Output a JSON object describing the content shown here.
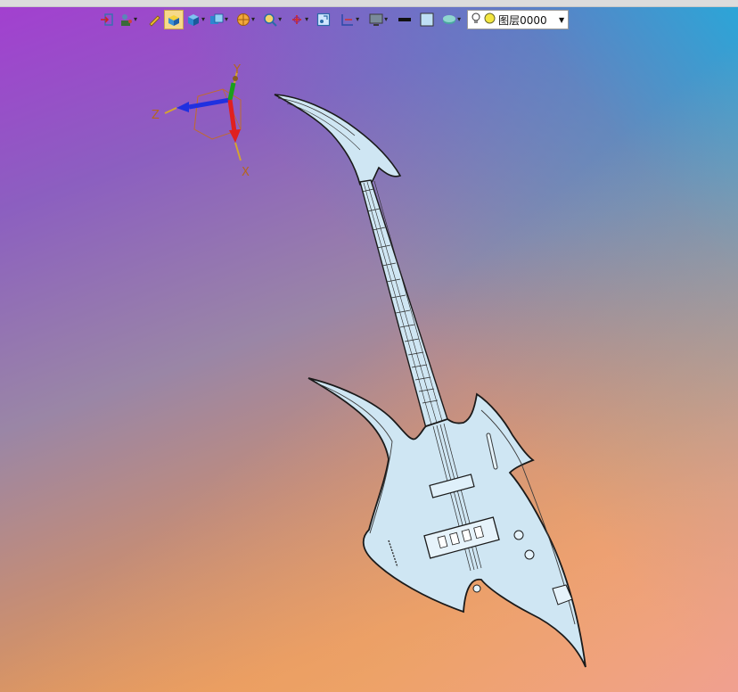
{
  "toolbar": {
    "buttons": [
      {
        "name": "exit-sketch",
        "icon": "exit-icon",
        "dropdown": false
      },
      {
        "name": "render-mode",
        "icon": "user-view-icon",
        "dropdown": true
      },
      {
        "name": "pencil",
        "icon": "pencil-icon",
        "dropdown": false
      },
      {
        "name": "shaded",
        "icon": "shaded-box-icon",
        "dropdown": false,
        "active": true
      },
      {
        "name": "view-cube",
        "icon": "cube-icon",
        "dropdown": true
      },
      {
        "name": "standard-views",
        "icon": "views-icon",
        "dropdown": true
      },
      {
        "name": "section",
        "icon": "section-icon",
        "dropdown": true
      },
      {
        "name": "zoom",
        "icon": "zoom-icon",
        "dropdown": true
      },
      {
        "name": "snap",
        "icon": "snap-icon",
        "dropdown": true
      },
      {
        "name": "fit-view",
        "icon": "fit-icon",
        "dropdown": false
      },
      {
        "name": "grid",
        "icon": "grid-icon",
        "dropdown": true
      },
      {
        "name": "display",
        "icon": "monitor-icon",
        "dropdown": true
      },
      {
        "name": "line-style",
        "icon": "line-icon",
        "dropdown": false
      },
      {
        "name": "color",
        "icon": "color-swatch-icon",
        "dropdown": false
      },
      {
        "name": "surface",
        "icon": "surface-icon",
        "dropdown": true
      }
    ],
    "layer": {
      "name": "图层0000",
      "visible_icon": "bulb-icon",
      "color_icon": "yellow-dot-icon"
    }
  },
  "triad": {
    "x": "X",
    "y": "Y",
    "z": "Z"
  },
  "colors": {
    "model_fill": "#cfe6f3",
    "model_edge": "#1a1a1a",
    "x_axis": "#e02020",
    "y_axis": "#1aa01a",
    "z_axis": "#2030e0"
  }
}
